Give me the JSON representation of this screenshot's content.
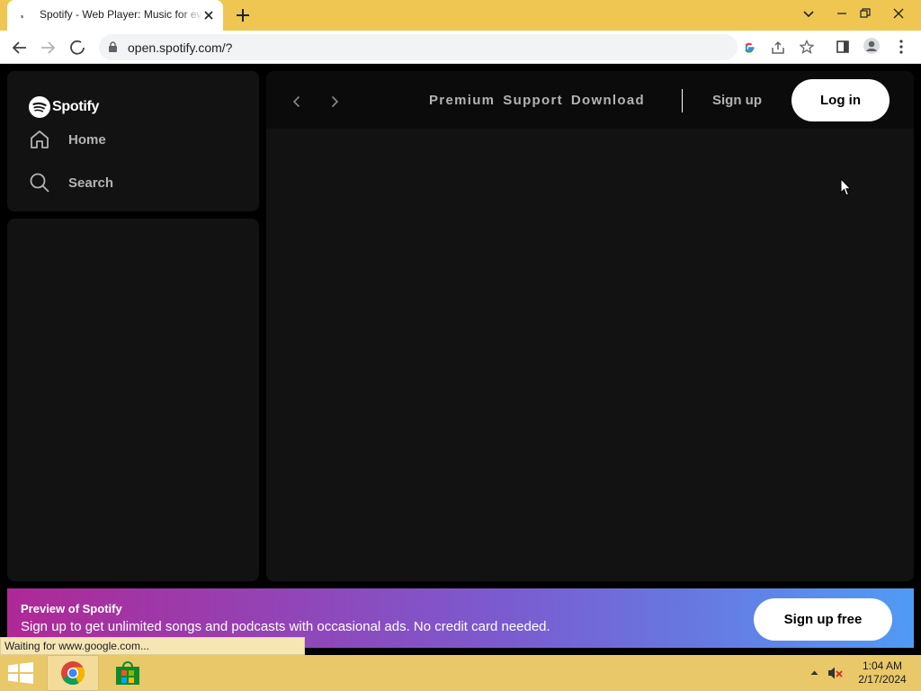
{
  "browser": {
    "tab_title": "Spotify - Web Player: Music for everyone",
    "url": "open.spotify.com/?",
    "status_text": "Waiting for www.google.com..."
  },
  "sidebar": {
    "logo_text": "Spotify",
    "items": [
      {
        "label": "Home",
        "icon": "home-icon"
      },
      {
        "label": "Search",
        "icon": "search-icon"
      }
    ]
  },
  "header": {
    "links": [
      "Premium",
      "Support",
      "Download"
    ],
    "signup_label": "Sign up",
    "login_label": "Log in"
  },
  "banner": {
    "title": "Preview of Spotify",
    "text": "Sign up to get unlimited songs and podcasts with occasional ads. No credit card needed.",
    "button_label": "Sign up free"
  },
  "taskbar": {
    "time": "1:04 AM",
    "date": "2/17/2024"
  },
  "colors": {
    "spotify_bg": "#121212",
    "titlebar": "#f0c653",
    "taskbar": "#e8c868",
    "banner_start": "#af2896",
    "banner_end": "#509bf5"
  }
}
